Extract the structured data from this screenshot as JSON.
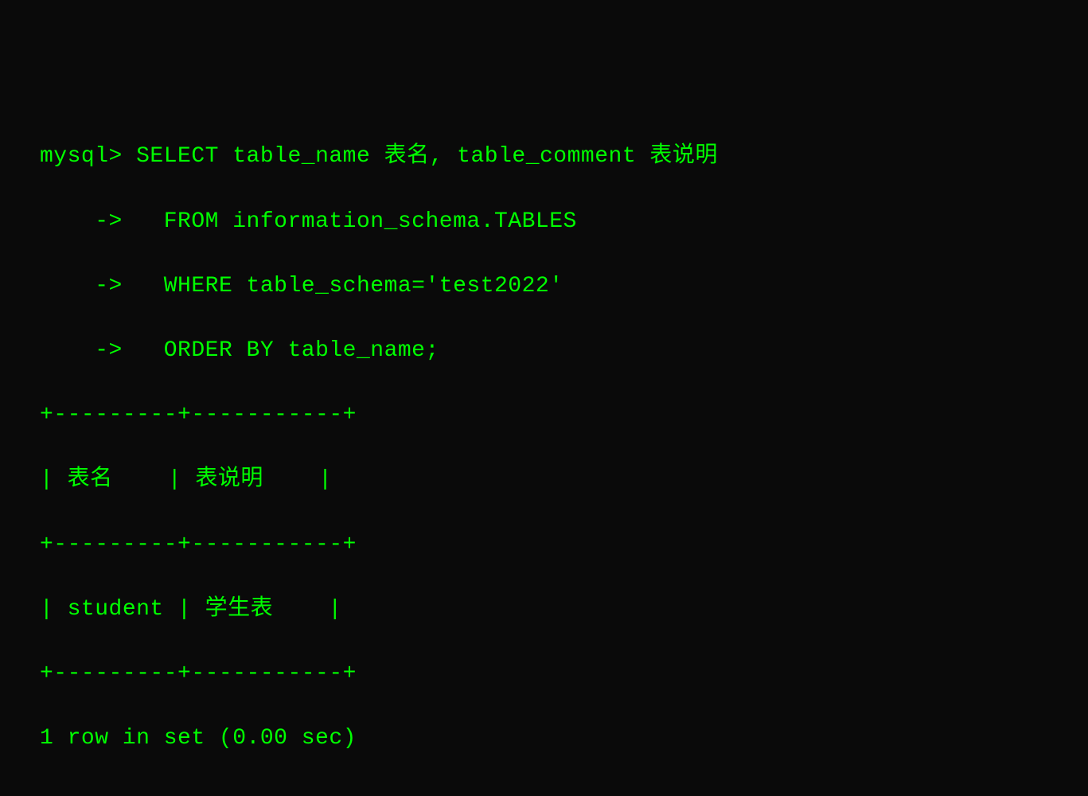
{
  "prompt": "mysql>",
  "continuation": "    ->",
  "query": {
    "line1": " SELECT table_name 表名, table_comment 表说明",
    "line2": "   FROM information_schema.TABLES",
    "line3": "   WHERE table_schema='test2022'",
    "line4": "   ORDER BY table_name;"
  },
  "table": {
    "border_top": "+---------+-----------+",
    "header": "| 表名    | 表说明    |",
    "border_mid": "+---------+-----------+",
    "row1": "| student | 学生表    |",
    "border_bot": "+---------+-----------+"
  },
  "result_status": "1 row in set (0.00 sec)"
}
